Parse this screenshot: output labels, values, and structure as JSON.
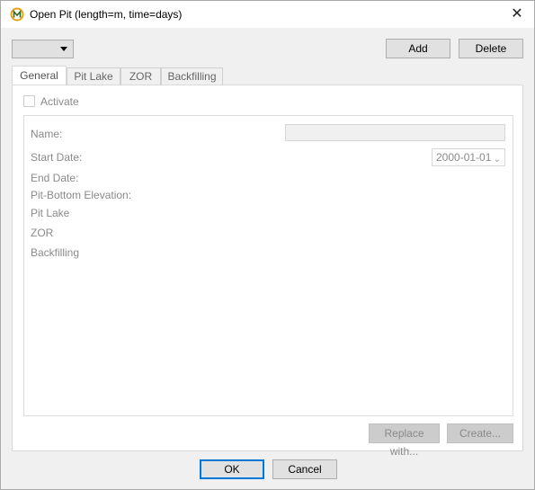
{
  "window": {
    "title": "Open Pit (length=m, time=days)",
    "close_glyph": "✕",
    "icon": "app-logo-icon"
  },
  "toolbar": {
    "selector_value": "",
    "add_label": "Add",
    "delete_label": "Delete"
  },
  "tabs": [
    {
      "label": "General",
      "active": true
    },
    {
      "label": "Pit Lake",
      "active": false
    },
    {
      "label": "ZOR",
      "active": false
    },
    {
      "label": "Backfilling",
      "active": false
    }
  ],
  "general": {
    "activate_label": "Activate",
    "activate_checked": false,
    "name_label": "Name:",
    "name_value": "",
    "start_date_label": "Start Date:",
    "start_date_value": "2000-01-01",
    "end_date_label": "End Date:",
    "pit_bottom_label": "Pit-Bottom Elevation:",
    "pit_lake_label": "Pit Lake",
    "zor_label": "ZOR",
    "backfilling_label": "Backfilling"
  },
  "panel_buttons": {
    "replace_label": "Replace with...",
    "create_label": "Create..."
  },
  "footer": {
    "ok_label": "OK",
    "cancel_label": "Cancel"
  },
  "colors": {
    "accent": "#0078d7",
    "disabled_text": "#8a8a8a",
    "window_bg": "#f0f0f0"
  }
}
